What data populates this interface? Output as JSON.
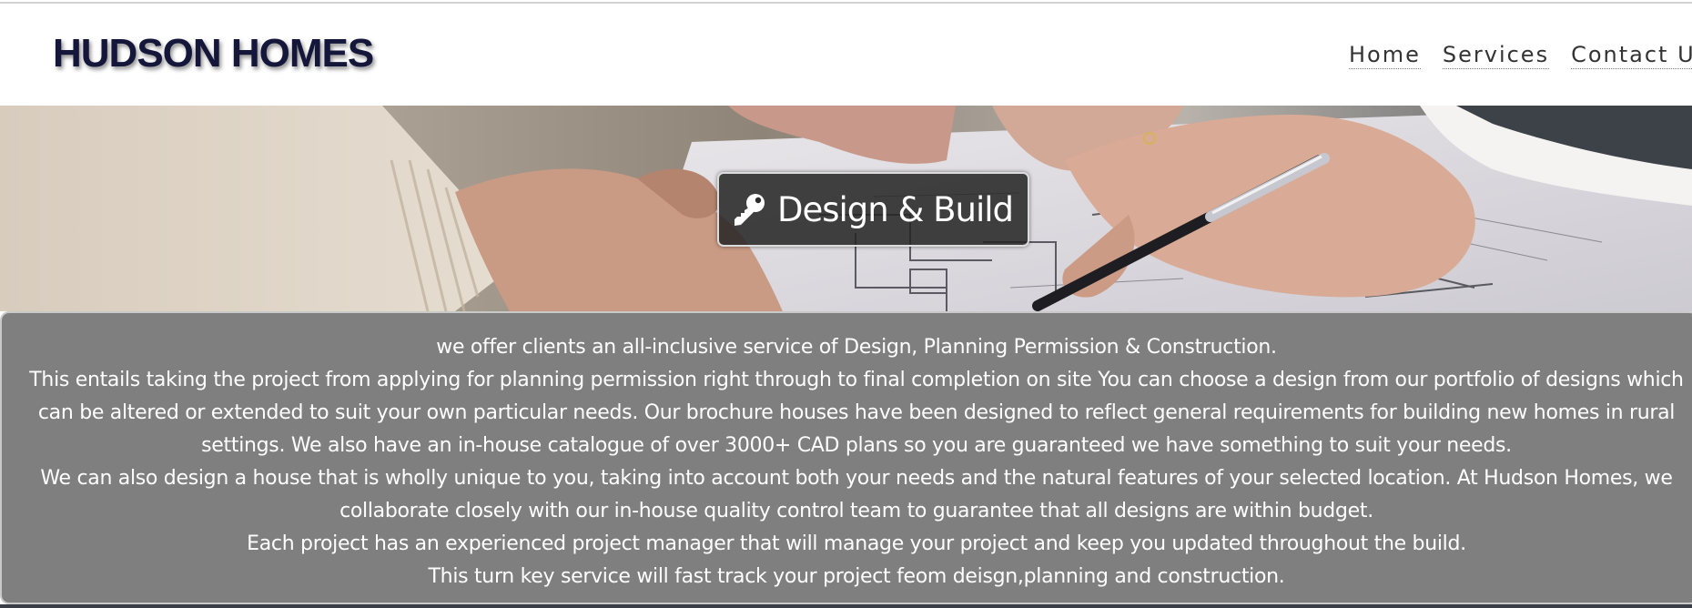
{
  "header": {
    "logo_text": "HUDSON HOMES"
  },
  "nav": {
    "items": [
      {
        "label": "Home"
      },
      {
        "label": "Services"
      },
      {
        "label": "Contact Us"
      }
    ]
  },
  "hero": {
    "icon": "key-icon",
    "title": "Design & Build"
  },
  "content": {
    "paragraphs": [
      "we offer clients an all-inclusive service of Design, Planning Permission & Construction.",
      "This entails taking the project from applying for planning permission right through to final completion on site You can choose a design from our portfolio of designs which can be altered or extended to suit your own particular needs. Our brochure houses have been designed to reflect general requirements for building new homes in rural settings. We also have an in-house catalogue of over 3000+ CAD plans so you are guaranteed we have something to suit your needs.",
      "We can also design a house that is wholly unique to you, taking into account both your needs and the natural features of your selected location. At Hudson Homes, we collaborate closely with our in-house quality control team to guarantee that all designs are within budget.",
      "Each project has an experienced project manager that will manage your project and keep you updated throughout the build.",
      "This turn key service will fast track your project feom deisgn,planning and construction."
    ]
  },
  "colors": {
    "logo": "#14163a",
    "nav_text": "#333333",
    "panel_background": "#7f7f7f",
    "badge_background": "#242424",
    "text_on_dark": "#ffffff"
  }
}
